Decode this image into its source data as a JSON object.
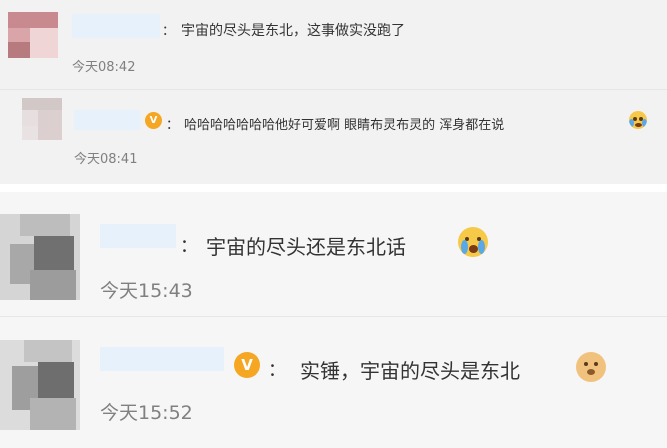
{
  "comments": [
    {
      "text": "宇宙的尽头是东北，这事做实没跑了",
      "time": "今天08:42",
      "colon": "："
    },
    {
      "text": "哈哈哈哈哈哈哈他好可爱啊 眼睛布灵布灵的 浑身都在说",
      "time": "今天08:41",
      "colon": "：",
      "badge": "V",
      "emoji": "crying-laugh-emoji"
    },
    {
      "text": "宇宙的尽头还是东北话",
      "time": "今天15:43",
      "colon": "：",
      "emoji": "crying-emoji"
    },
    {
      "text": "实锤，宇宙的尽头是东北",
      "time": "今天15:52",
      "colon": "：",
      "badge": "V",
      "emoji": "doge-emoji"
    }
  ],
  "colors": {
    "text": "#333333",
    "time": "#808080",
    "vip_badge": "#f5a623",
    "username_blur": "#e7f1fb"
  }
}
